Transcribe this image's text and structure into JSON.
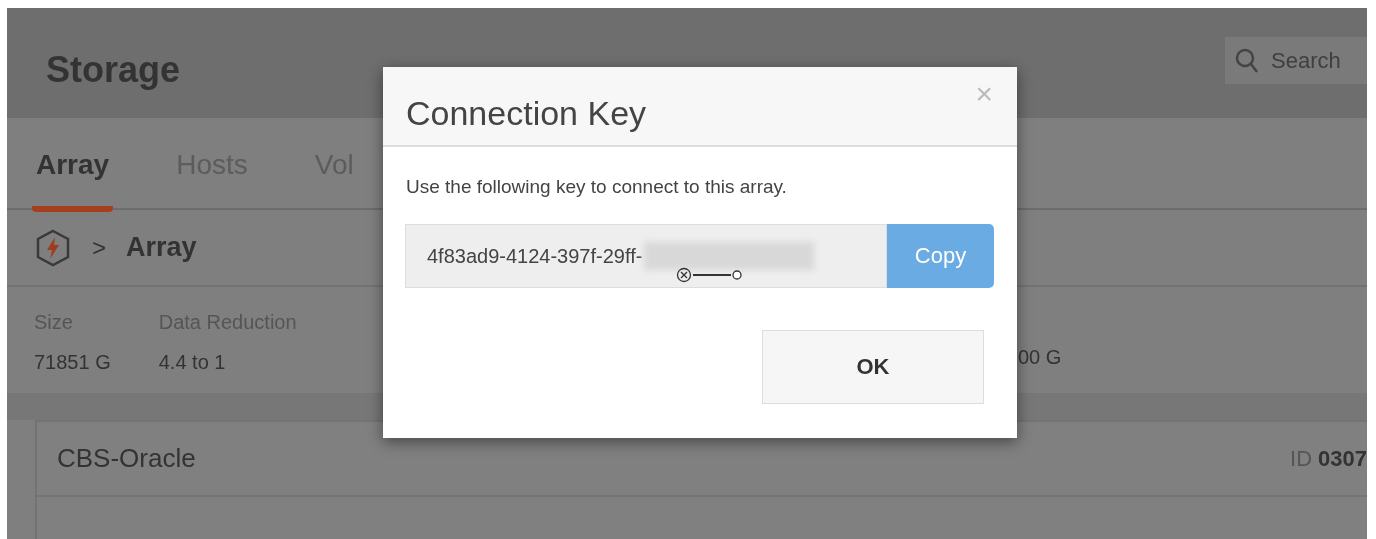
{
  "page": {
    "title": "Storage",
    "search": {
      "placeholder": "Search"
    }
  },
  "tabs": [
    {
      "label": "Array",
      "selected": true
    },
    {
      "label": "Hosts",
      "selected": false
    },
    {
      "label": "Vol",
      "selected": false
    }
  ],
  "breadcrumb": {
    "separator": ">",
    "current": "Array"
  },
  "stats": [
    {
      "label": "Size",
      "value": "71851 G"
    },
    {
      "label": "Data Reduction",
      "value": "4.4 to 1"
    },
    {
      "value": "00 G"
    }
  ],
  "card": {
    "title": "CBS-Oracle",
    "id_label": "ID",
    "id_value": "0307"
  },
  "dialog": {
    "title": "Connection Key",
    "close": "×",
    "message": "Use the following key to connect to this array.",
    "key_value": "4f83ad9-4124-397f-29ff-",
    "copy_button": "Copy",
    "ok_button": "OK"
  }
}
